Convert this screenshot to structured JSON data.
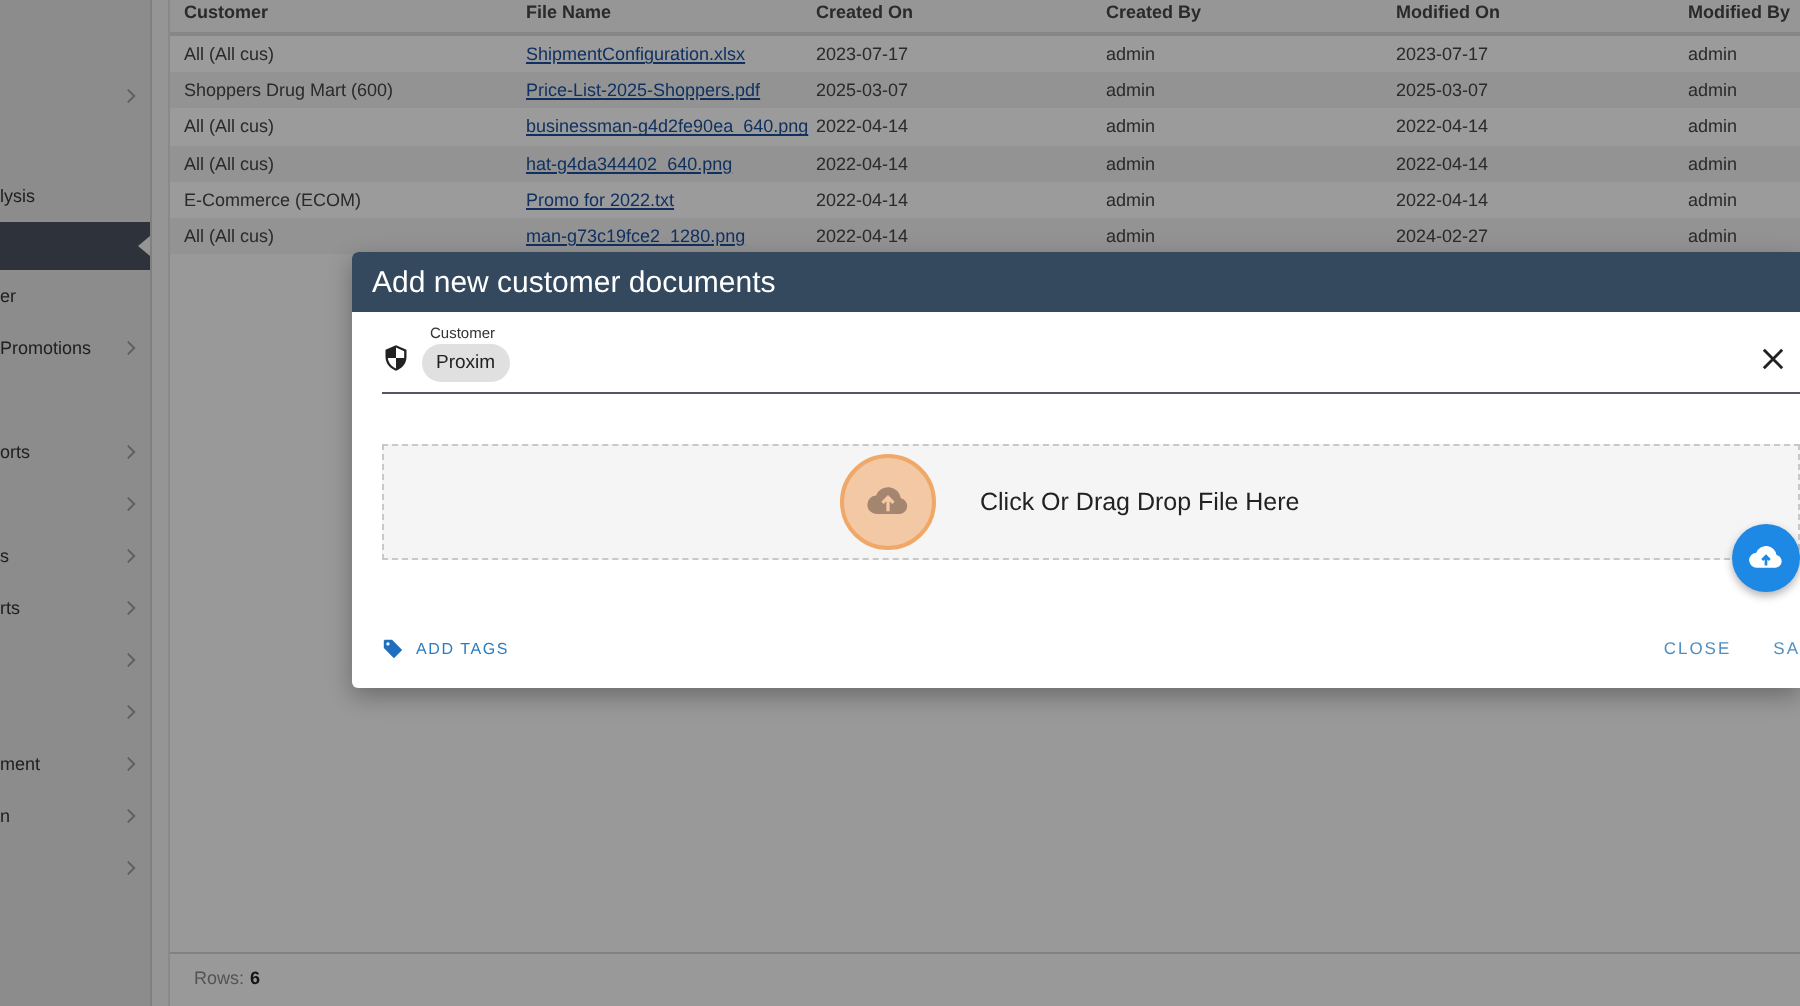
{
  "sidebar": {
    "items": [
      {
        "expandable": true,
        "selected": false
      },
      {
        "label": "lysis",
        "expandable": false,
        "selected": false
      },
      {
        "expandable": false,
        "selected": true
      },
      {
        "label": "er",
        "expandable": false,
        "selected": false
      },
      {
        "label": "Promotions",
        "expandable": true,
        "selected": false
      },
      {
        "label": "orts",
        "expandable": true,
        "selected": false
      },
      {
        "expandable": true,
        "selected": false
      },
      {
        "label": "s",
        "expandable": true,
        "selected": false
      },
      {
        "label": "rts",
        "expandable": true,
        "selected": false
      },
      {
        "expandable": true,
        "selected": false
      },
      {
        "expandable": true,
        "selected": false
      },
      {
        "label": "ment",
        "expandable": true,
        "selected": false
      },
      {
        "label": "n",
        "expandable": true,
        "selected": false
      },
      {
        "expandable": true,
        "selected": false
      }
    ]
  },
  "table": {
    "columns": [
      "Customer",
      "File Name",
      "Created On",
      "Created By",
      "Modified On",
      "Modified By"
    ],
    "rows": [
      [
        "All (All cus)",
        "ShipmentConfiguration.xlsx",
        "2023-07-17",
        "admin",
        "2023-07-17",
        "admin"
      ],
      [
        "Shoppers Drug Mart (600)",
        "Price-List-2025-Shoppers.pdf",
        "2025-03-07",
        "admin",
        "2025-03-07",
        "admin"
      ],
      [
        "All (All cus)",
        "businessman-g4d2fe90ea_640.png",
        "2022-04-14",
        "admin",
        "2022-04-14",
        "admin"
      ],
      [
        "All (All cus)",
        "hat-g4da344402_640.png",
        "2022-04-14",
        "admin",
        "2022-04-14",
        "admin"
      ],
      [
        "E-Commerce (ECOM)",
        "Promo for 2022.txt",
        "2022-04-14",
        "admin",
        "2022-04-14",
        "admin"
      ],
      [
        "All (All cus)",
        "man-g73c19fce2_1280.png",
        "2022-04-14",
        "admin",
        "2024-02-27",
        "admin"
      ]
    ],
    "footer": {
      "label": "Rows:",
      "count": "6"
    }
  },
  "dialog": {
    "title": "Add new customer documents",
    "customer_field": {
      "label": "Customer",
      "chips": [
        "Proxim"
      ]
    },
    "dropzone": {
      "text": "Click Or Drag Drop File Here"
    },
    "actions": {
      "add_tags": "ADD TAGS",
      "buttons": [
        "CLOSE",
        "SA"
      ]
    }
  }
}
